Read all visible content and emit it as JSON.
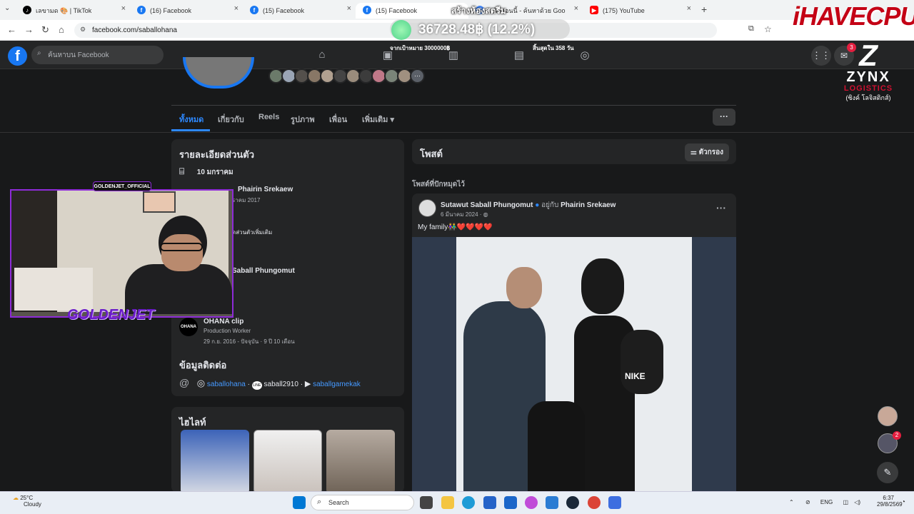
{
  "browser": {
    "tabs": [
      {
        "label": "เลขามด 🎨 | TikTok",
        "icon": "tiktok-icon"
      },
      {
        "label": "(16) Facebook",
        "icon": "facebook-icon"
      },
      {
        "label": "(15) Facebook",
        "icon": "facebook-icon"
      },
      {
        "label": "(15) Facebook",
        "icon": "facebook-icon",
        "active": true
      },
      {
        "label": "หน้าต่อนนี้ - ค้นหาด้วย Goo",
        "icon": "google-icon"
      },
      {
        "label": "(175) YouTube",
        "icon": "youtube-icon"
      }
    ],
    "new_tab": "+",
    "url": "facebook.com/saballohana"
  },
  "overlay": {
    "balance": "36728.48฿ (12.2%)",
    "room_title": "สร้างห้องสตรีม",
    "brand": "iHAVECPU",
    "sponsor_letter": "Z",
    "sponsor_name": "ZYNX",
    "sponsor_sub": "LOGISTICS",
    "sponsor_thai": "(ซิงค์ โลจิสติกส์)",
    "goal_left": "จากเป้าหมาย 3000000฿",
    "goal_right": "สิ้นสุดใน 358 วัน",
    "cam_tag": "GOLDENJET_OFFICIAL",
    "cam_name": "GOLDENJET"
  },
  "facebook": {
    "search_placeholder": "ค้นหาบน Facebook",
    "messenger_badge": "3",
    "profile_tabs": [
      "ทั้งหมด",
      "เกี่ยวกับ",
      "Reels",
      "รูปภาพ",
      "เพื่อน",
      "เพิ่มเติม ▾"
    ],
    "intro": {
      "title": "รายละเอียดส่วนตัว",
      "birthday": "10 มกราคม",
      "relationship": "Phairin Srekaew",
      "relationship_sub": "ราคม 2017",
      "more_details": "ดส่วนตัวเพิ่มเติม",
      "family": "Saball Phungomut",
      "work_title": "OHANA clip",
      "work_role": "Production Worker",
      "work_period": "29 ก.ย. 2016 - ปัจจุบัน · 9 ปี 10 เดือน",
      "work_logo": "OHANA"
    },
    "contact": {
      "title": "ข้อมูลติดต่อ",
      "instagram": "saballohana",
      "line": "saball2910",
      "youtube": "saballgamekak",
      "sep": "·"
    },
    "highlights_title": "ไฮไลท์",
    "posts": {
      "title": "โพสต์",
      "filter": "ตัวกรอง",
      "pinned": "โพสต์ที่ปักหมุดไว้",
      "author": "Sutawut Saball Phungomut",
      "with": "อยู่กับ",
      "with_name": "Phairin Srekaew",
      "date": "6 มีนาคม 2024 · ",
      "text": "My family👫❤️❤️❤️❤️",
      "shirt_text": "NIKE"
    },
    "chat_badge": "2"
  },
  "taskbar": {
    "temp": "25°C",
    "weather": "Cloudy",
    "search": "Search",
    "lang": "ENG",
    "time": "6:37",
    "date": "29/8/2569"
  },
  "colors": {
    "fb_blue": "#1877f2",
    "link_blue": "#4599ff",
    "stream_purple": "#8e2bd8"
  }
}
